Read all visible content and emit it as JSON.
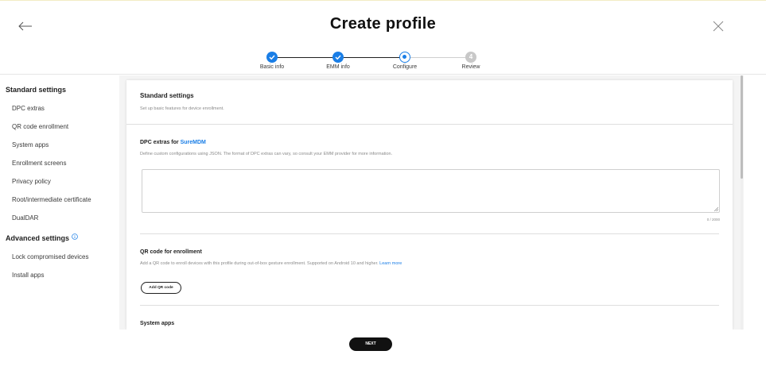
{
  "header": {
    "title": "Create profile"
  },
  "stepper": {
    "steps": [
      {
        "label": "Basic info",
        "state": "done"
      },
      {
        "label": "EMM info",
        "state": "done"
      },
      {
        "label": "Configure",
        "state": "current"
      },
      {
        "label": "Review",
        "state": "todo",
        "number": "4"
      }
    ]
  },
  "sidebar": {
    "standard_heading": "Standard settings",
    "standard_items": [
      {
        "label": "DPC extras"
      },
      {
        "label": "QR code enrollment"
      },
      {
        "label": "System apps"
      },
      {
        "label": "Enrollment screens"
      },
      {
        "label": "Privacy policy"
      },
      {
        "label": "Root/intermediate certificate"
      },
      {
        "label": "DualDAR"
      }
    ],
    "advanced_heading": "Advanced settings",
    "advanced_items": [
      {
        "label": "Lock compromised devices"
      },
      {
        "label": "Install apps"
      }
    ]
  },
  "main": {
    "standard": {
      "title": "Standard settings",
      "desc": "Set up basic features for device enrollment."
    },
    "dpc": {
      "title_prefix": "DPC extras for ",
      "title_link": "SureMDM",
      "desc": "Define custom configurations using JSON. The format of DPC extras can vary, so consult your EMM provider for more information.",
      "value": "",
      "counter": "0 / 2000"
    },
    "qr": {
      "title": "QR code for enrollment",
      "desc": "Add a QR code to enroll devices with this profile during out-of-box gesture enrollment. Supported on Android 10 and higher.",
      "learn_more": "Learn more",
      "button": "Add QR code"
    },
    "system_apps": {
      "title": "System apps"
    }
  },
  "footer": {
    "next_label": "NEXT"
  },
  "colors": {
    "accent": "#1a7ee6",
    "primary_button": "#111111"
  }
}
